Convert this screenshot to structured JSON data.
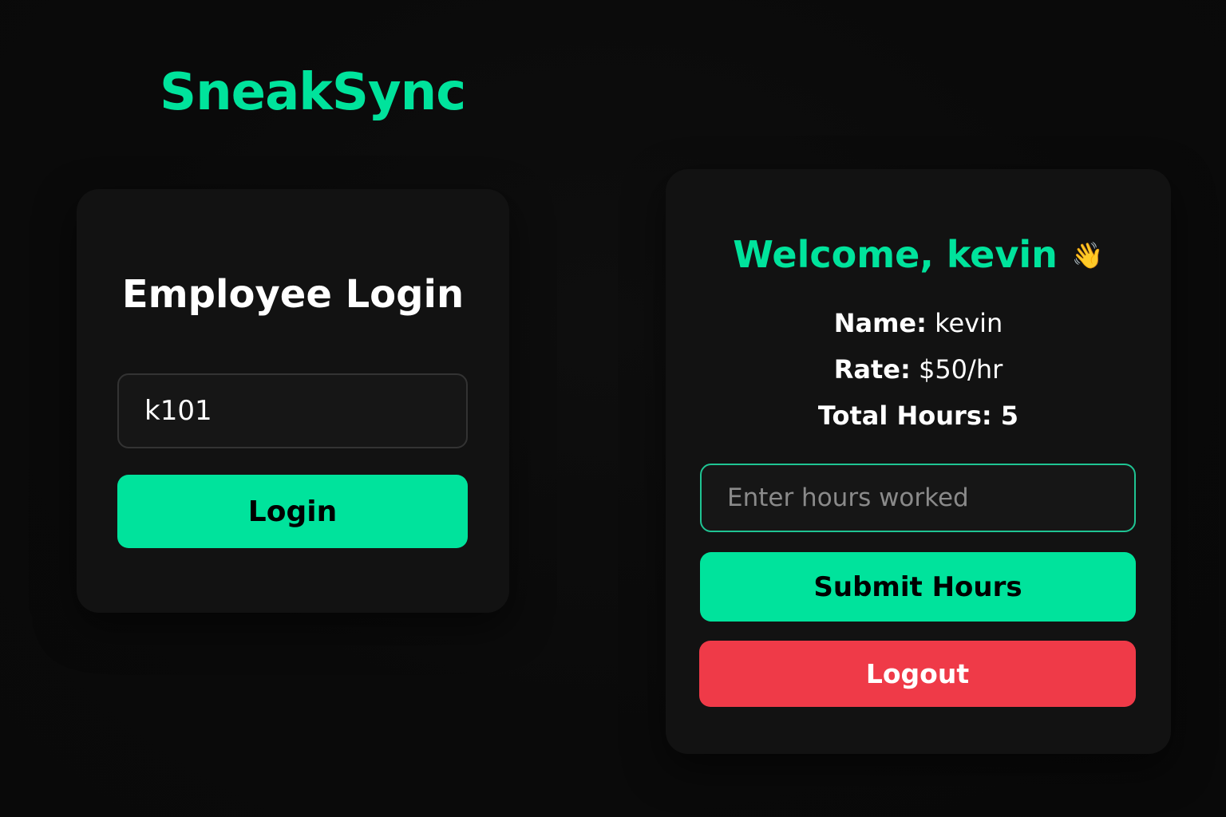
{
  "app": {
    "brand": "SneakSync",
    "accent_color": "#00e39c",
    "danger_color": "#ef3a48"
  },
  "login": {
    "title": "Employee Login",
    "employee_id_value": "k101",
    "login_label": "Login"
  },
  "dashboard": {
    "welcome_text": "Welcome, kevin",
    "welcome_icon": "waving-hand-icon",
    "name_label": "Name:",
    "name_value": "kevin",
    "rate_label": "Rate:",
    "rate_value": "$50/hr",
    "total_hours_label": "Total Hours:",
    "total_hours_value": "5",
    "hours_placeholder": "Enter hours worked",
    "submit_label": "Submit Hours",
    "logout_label": "Logout"
  }
}
